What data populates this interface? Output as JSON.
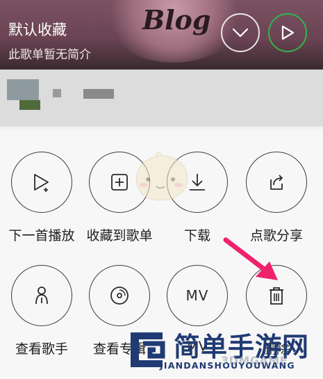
{
  "header": {
    "title": "默认收藏",
    "subtitle": "此歌单暂无简介",
    "deco_text": "Blog"
  },
  "header_controls": {
    "collapse_icon": "chevron-down-icon",
    "play_icon": "play-icon",
    "play_accent": "#33b34d"
  },
  "actions": [
    {
      "label": "下一首播放",
      "icon": "play-next-icon"
    },
    {
      "label": "收藏到歌单",
      "icon": "add-to-playlist-icon"
    },
    {
      "label": "下载",
      "icon": "download-icon"
    },
    {
      "label": "点歌分享",
      "icon": "share-icon"
    },
    {
      "label": "查看歌手",
      "icon": "singer-icon"
    },
    {
      "label": "查看专辑",
      "icon": "album-icon"
    },
    {
      "label": "MV",
      "icon": "mv-icon"
    },
    {
      "label": "删除",
      "icon": "trash-icon"
    }
  ],
  "mv_icon_text": "MV",
  "arrow_color": "#f0226d",
  "watermark": {
    "cn": "简单手游网",
    "en": "JIANDANSHOUYOUWANG",
    "brand": "3DMGAME"
  }
}
